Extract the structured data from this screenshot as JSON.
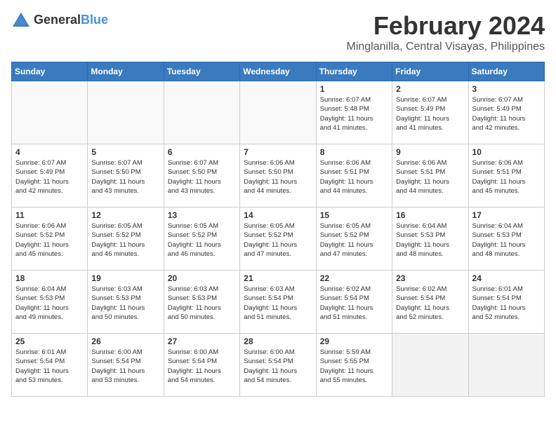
{
  "logo": {
    "general": "General",
    "blue": "Blue"
  },
  "title": {
    "month": "February 2024",
    "location": "Minglanilla, Central Visayas, Philippines"
  },
  "headers": [
    "Sunday",
    "Monday",
    "Tuesday",
    "Wednesday",
    "Thursday",
    "Friday",
    "Saturday"
  ],
  "weeks": [
    [
      {
        "day": "",
        "info": ""
      },
      {
        "day": "",
        "info": ""
      },
      {
        "day": "",
        "info": ""
      },
      {
        "day": "",
        "info": ""
      },
      {
        "day": "1",
        "info": "Sunrise: 6:07 AM\nSunset: 5:48 PM\nDaylight: 11 hours\nand 41 minutes."
      },
      {
        "day": "2",
        "info": "Sunrise: 6:07 AM\nSunset: 5:49 PM\nDaylight: 11 hours\nand 41 minutes."
      },
      {
        "day": "3",
        "info": "Sunrise: 6:07 AM\nSunset: 5:49 PM\nDaylight: 11 hours\nand 42 minutes."
      }
    ],
    [
      {
        "day": "4",
        "info": "Sunrise: 6:07 AM\nSunset: 5:49 PM\nDaylight: 11 hours\nand 42 minutes."
      },
      {
        "day": "5",
        "info": "Sunrise: 6:07 AM\nSunset: 5:50 PM\nDaylight: 11 hours\nand 43 minutes."
      },
      {
        "day": "6",
        "info": "Sunrise: 6:07 AM\nSunset: 5:50 PM\nDaylight: 11 hours\nand 43 minutes."
      },
      {
        "day": "7",
        "info": "Sunrise: 6:06 AM\nSunset: 5:50 PM\nDaylight: 11 hours\nand 44 minutes."
      },
      {
        "day": "8",
        "info": "Sunrise: 6:06 AM\nSunset: 5:51 PM\nDaylight: 11 hours\nand 44 minutes."
      },
      {
        "day": "9",
        "info": "Sunrise: 6:06 AM\nSunset: 5:51 PM\nDaylight: 11 hours\nand 44 minutes."
      },
      {
        "day": "10",
        "info": "Sunrise: 6:06 AM\nSunset: 5:51 PM\nDaylight: 11 hours\nand 45 minutes."
      }
    ],
    [
      {
        "day": "11",
        "info": "Sunrise: 6:06 AM\nSunset: 5:52 PM\nDaylight: 11 hours\nand 45 minutes."
      },
      {
        "day": "12",
        "info": "Sunrise: 6:05 AM\nSunset: 5:52 PM\nDaylight: 11 hours\nand 46 minutes."
      },
      {
        "day": "13",
        "info": "Sunrise: 6:05 AM\nSunset: 5:52 PM\nDaylight: 11 hours\nand 46 minutes."
      },
      {
        "day": "14",
        "info": "Sunrise: 6:05 AM\nSunset: 5:52 PM\nDaylight: 11 hours\nand 47 minutes."
      },
      {
        "day": "15",
        "info": "Sunrise: 6:05 AM\nSunset: 5:52 PM\nDaylight: 11 hours\nand 47 minutes."
      },
      {
        "day": "16",
        "info": "Sunrise: 6:04 AM\nSunset: 5:53 PM\nDaylight: 11 hours\nand 48 minutes."
      },
      {
        "day": "17",
        "info": "Sunrise: 6:04 AM\nSunset: 5:53 PM\nDaylight: 11 hours\nand 48 minutes."
      }
    ],
    [
      {
        "day": "18",
        "info": "Sunrise: 6:04 AM\nSunset: 5:53 PM\nDaylight: 11 hours\nand 49 minutes."
      },
      {
        "day": "19",
        "info": "Sunrise: 6:03 AM\nSunset: 5:53 PM\nDaylight: 11 hours\nand 50 minutes."
      },
      {
        "day": "20",
        "info": "Sunrise: 6:03 AM\nSunset: 5:53 PM\nDaylight: 11 hours\nand 50 minutes."
      },
      {
        "day": "21",
        "info": "Sunrise: 6:03 AM\nSunset: 5:54 PM\nDaylight: 11 hours\nand 51 minutes."
      },
      {
        "day": "22",
        "info": "Sunrise: 6:02 AM\nSunset: 5:54 PM\nDaylight: 11 hours\nand 51 minutes."
      },
      {
        "day": "23",
        "info": "Sunrise: 6:02 AM\nSunset: 5:54 PM\nDaylight: 11 hours\nand 52 minutes."
      },
      {
        "day": "24",
        "info": "Sunrise: 6:01 AM\nSunset: 5:54 PM\nDaylight: 11 hours\nand 52 minutes."
      }
    ],
    [
      {
        "day": "25",
        "info": "Sunrise: 6:01 AM\nSunset: 5:54 PM\nDaylight: 11 hours\nand 53 minutes."
      },
      {
        "day": "26",
        "info": "Sunrise: 6:00 AM\nSunset: 5:54 PM\nDaylight: 11 hours\nand 53 minutes."
      },
      {
        "day": "27",
        "info": "Sunrise: 6:00 AM\nSunset: 5:54 PM\nDaylight: 11 hours\nand 54 minutes."
      },
      {
        "day": "28",
        "info": "Sunrise: 6:00 AM\nSunset: 5:54 PM\nDaylight: 11 hours\nand 54 minutes."
      },
      {
        "day": "29",
        "info": "Sunrise: 5:59 AM\nSunset: 5:55 PM\nDaylight: 11 hours\nand 55 minutes."
      },
      {
        "day": "",
        "info": ""
      },
      {
        "day": "",
        "info": ""
      }
    ]
  ]
}
